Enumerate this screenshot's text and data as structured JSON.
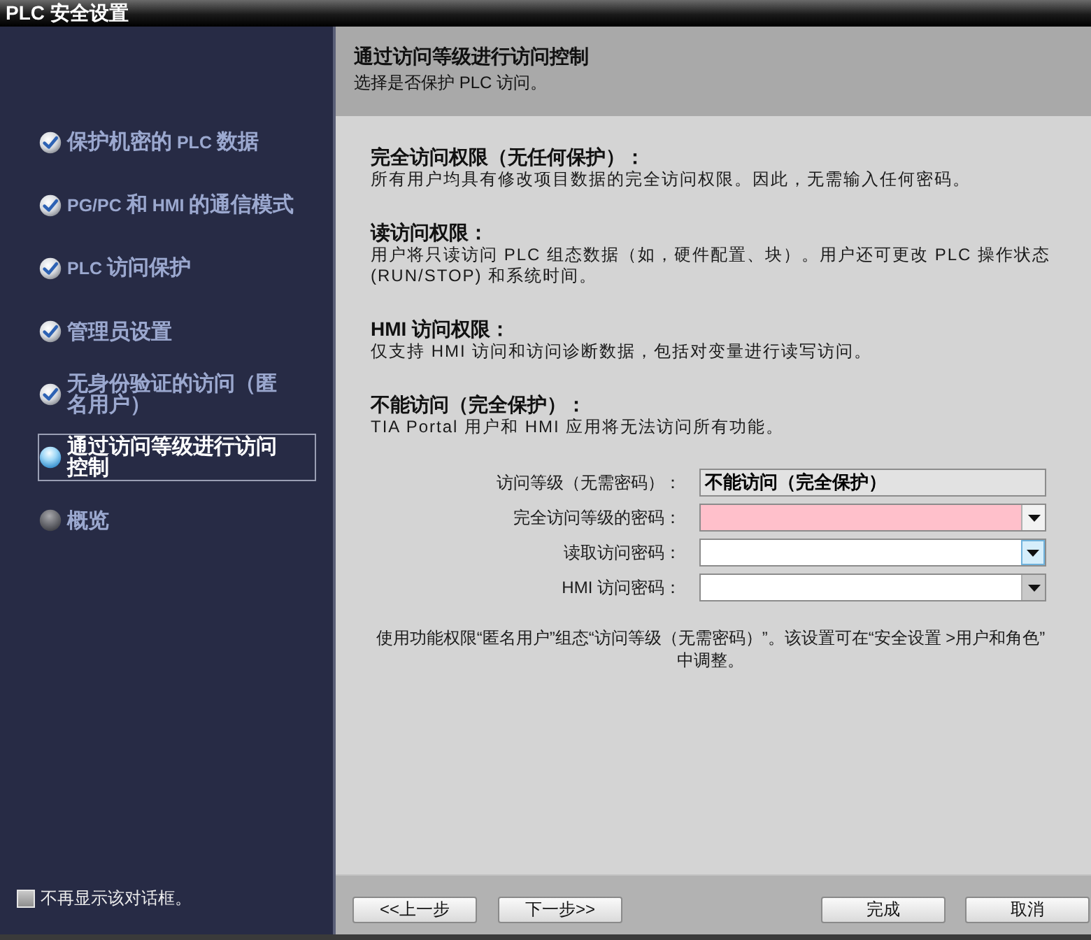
{
  "window": {
    "title": "PLC 安全设置"
  },
  "sidebar": {
    "items": [
      {
        "label": "保护机密的 PLC 数据",
        "completed": true,
        "selected": false
      },
      {
        "label": "PG/PC 和 HMI 的通信模式",
        "completed": true,
        "selected": false
      },
      {
        "label": "PLC 访问保护",
        "completed": true,
        "selected": false
      },
      {
        "label": "管理员设置",
        "completed": true,
        "selected": false
      },
      {
        "label": "无身份验证的访问（匿名用户）",
        "completed": true,
        "selected": false
      },
      {
        "label": "通过访问等级进行访问控制",
        "completed": false,
        "selected": true
      },
      {
        "label": "概览",
        "completed": false,
        "selected": false
      }
    ],
    "dont_show_again": {
      "label": "不再显示该对话框。",
      "checked": false
    }
  },
  "header": {
    "title": "通过访问等级进行访问控制",
    "subtitle": "选择是否保护 PLC 访问。"
  },
  "sections": [
    {
      "heading": "完全访问权限（无任何保护）：",
      "text": "所有用户均具有修改项目数据的完全访问权限。因此，无需输入任何密码。"
    },
    {
      "heading": "读访问权限：",
      "text": "用户将只读访问 PLC 组态数据（如，硬件配置、块）。用户还可更改 PLC 操作状态 (RUN/STOP) 和系统时间。"
    },
    {
      "heading": "HMI 访问权限：",
      "text": "仅支持 HMI 访问和访问诊断数据，包括对变量进行读写访问。"
    },
    {
      "heading": "不能访问（完全保护）：",
      "text": "TIA Portal 用户和 HMI 应用将无法访问所有功能。"
    }
  ],
  "form": {
    "fields": [
      {
        "label": "访问等级（无需密码）：",
        "kind": "display",
        "value": "不能访问（完全保护）"
      },
      {
        "label": "完全访问等级的密码：",
        "kind": "dropdown",
        "error": true,
        "hovered": false,
        "arrow_disabled": false
      },
      {
        "label": "读取访问密码：",
        "kind": "dropdown",
        "error": false,
        "hovered": true,
        "arrow_disabled": false
      },
      {
        "label": "HMI 访问密码：",
        "kind": "dropdown",
        "error": false,
        "hovered": false,
        "arrow_disabled": true
      }
    ]
  },
  "note": "使用功能权限“匿名用户”组态“访问等级（无需密码）”。该设置可在“安全设置 >用户和角色”中调整。",
  "nav_buttons": [
    {
      "label": "<<上一步"
    },
    {
      "label": "下一步>>"
    }
  ],
  "action_buttons": [
    {
      "label": "完成"
    },
    {
      "label": "取消"
    }
  ]
}
